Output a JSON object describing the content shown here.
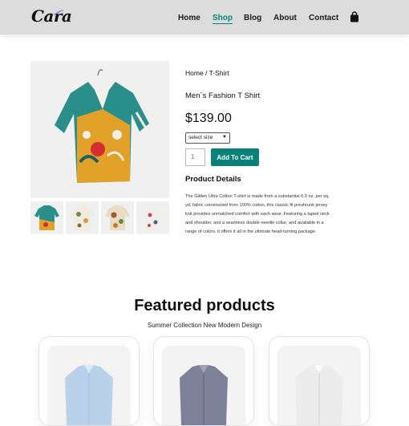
{
  "brand": {
    "name": "Cara"
  },
  "nav": {
    "items": [
      "Home",
      "Shop",
      "Blog",
      "About",
      "Contact"
    ],
    "active": "Shop",
    "cart_icon": "shopping-bag-icon"
  },
  "colors": {
    "accent": "#088178",
    "header_bg": "#dcdcdc"
  },
  "product": {
    "breadcrumb": "Home / T-Shirt",
    "title": "Men`s Fashion T Shirt",
    "price": "$139.00",
    "size_select": {
      "value": "select size"
    },
    "quantity": "1",
    "add_to_cart": "Add To Cart",
    "details_heading": "Product Details",
    "details_text": "The Gilden Ultra Cotton T-shirt is made from a substantial 6.0 oz. per sq. yd. fabric constructed from 100% cotton, this classic fit preshrunk jersey knit provides unmatched comfort with each wear. Featuring a taped neck and shoulder, and a seamless double-needle collar, and available in a range of colors, it offers it all in the ultimate head-turning package."
  },
  "featured": {
    "heading": "Featured products",
    "subheading": "Summer Collection New Modern Design"
  }
}
